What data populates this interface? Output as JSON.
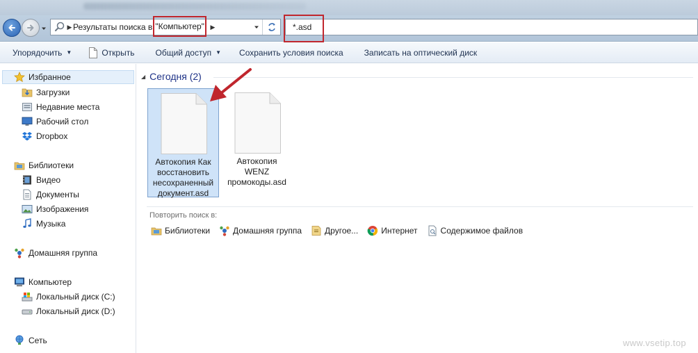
{
  "address": {
    "segment_1": "Результаты поиска в",
    "segment_2": "\"Компьютер\""
  },
  "search": {
    "value": "*.asd"
  },
  "toolbar": {
    "organize": "Упорядочить",
    "open": "Открыть",
    "share": "Общий доступ",
    "save_search": "Сохранить условия поиска",
    "burn": "Записать на оптический диск"
  },
  "sidebar": {
    "favorites": "Избранное",
    "downloads": "Загрузки",
    "recent": "Недавние места",
    "desktop": "Рабочий стол",
    "dropbox": "Dropbox",
    "libraries": "Библиотеки",
    "video": "Видео",
    "documents": "Документы",
    "images": "Изображения",
    "music": "Музыка",
    "homegroup": "Домашняя группа",
    "computer": "Компьютер",
    "disk_c": "Локальный диск (C:)",
    "disk_d": "Локальный диск (D:)",
    "network": "Сеть"
  },
  "main": {
    "group_title": "Сегодня (2)",
    "files": [
      {
        "line1": "Автокопия Как",
        "line2": "восстановить",
        "line3": "несохраненный",
        "line4": "документ.asd"
      },
      {
        "line1": "Автокопия",
        "line2": "WENZ",
        "line3": "промокоды.asd"
      }
    ],
    "repeat_label": "Повторить поиск в:",
    "repeat_items": {
      "libraries": "Библиотеки",
      "homegroup": "Домашняя группа",
      "other": "Другое...",
      "internet": "Интернет",
      "contents": "Содержимое файлов"
    }
  },
  "watermark": "www.vsetip.top",
  "colors": {
    "highlight_box": "#c0262d",
    "accent_arrow": "#c0262d",
    "selection": "#cfe3f8"
  }
}
